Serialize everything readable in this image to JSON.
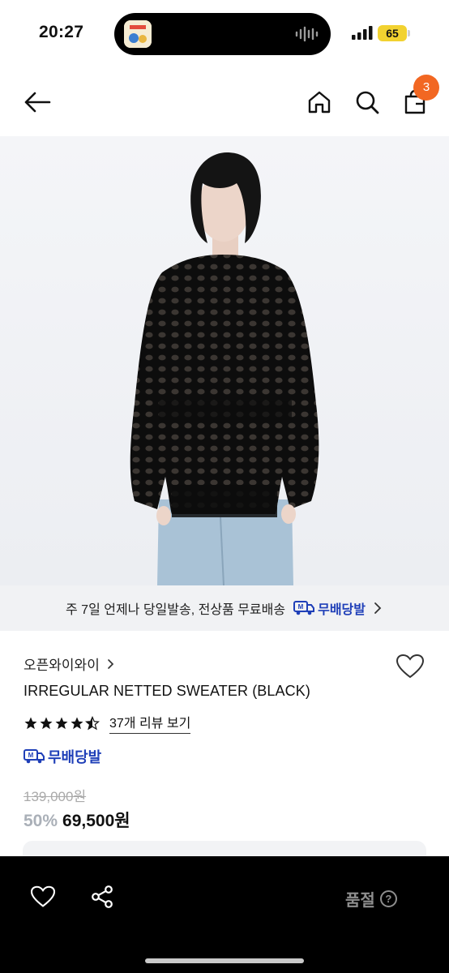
{
  "status_bar": {
    "time": "20:27",
    "battery": "65"
  },
  "nav": {
    "cart_count": "3"
  },
  "banner": {
    "text": "주 7일 언제나 당일발송, 전상품 무료배송",
    "service_label": "무배당발"
  },
  "product": {
    "brand": "오픈와이와이",
    "name": "IRREGULAR NETTED SWEATER (BLACK)",
    "rating": 4.5,
    "review_link": "37개 리뷰 보기",
    "badge": "무배당발",
    "original_price": "139,000원",
    "discount": "50%",
    "sale_price": "69,500원"
  },
  "bottom_bar": {
    "soldout_label": "품절"
  },
  "colors": {
    "accent": "#f26722",
    "service_blue": "#1f3fb8"
  }
}
